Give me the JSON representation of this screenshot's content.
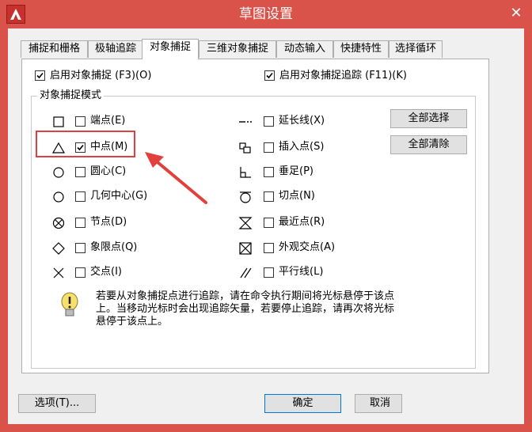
{
  "window": {
    "title": "草图设置",
    "close_glyph": "✕"
  },
  "tabs": [
    {
      "label": "捕捉和栅格"
    },
    {
      "label": "极轴追踪"
    },
    {
      "label": "对象捕捉"
    },
    {
      "label": "三维对象捕捉"
    },
    {
      "label": "动态输入"
    },
    {
      "label": "快捷特性"
    },
    {
      "label": "选择循环"
    }
  ],
  "top_options": {
    "snap_on": {
      "label": "启用对象捕捉 (F3)(O)",
      "checked": true
    },
    "tracking_on": {
      "label": "启用对象捕捉追踪 (F11)(K)",
      "checked": true
    }
  },
  "group_title": "对象捕捉模式",
  "modes_left": [
    {
      "label": "端点(E)",
      "icon": "square-icon",
      "checked": false
    },
    {
      "label": "中点(M)",
      "icon": "triangle-icon",
      "checked": true
    },
    {
      "label": "圆心(C)",
      "icon": "circle-icon",
      "checked": false
    },
    {
      "label": "几何中心(G)",
      "icon": "circle-icon",
      "checked": false
    },
    {
      "label": "节点(D)",
      "icon": "circle-x-icon",
      "checked": false
    },
    {
      "label": "象限点(Q)",
      "icon": "diamond-icon",
      "checked": false
    },
    {
      "label": "交点(I)",
      "icon": "x-icon",
      "checked": false
    }
  ],
  "modes_right": [
    {
      "label": "延长线(X)",
      "icon": "dash-dot-icon",
      "checked": false
    },
    {
      "label": "插入点(S)",
      "icon": "insert-icon",
      "checked": false
    },
    {
      "label": "垂足(P)",
      "icon": "perpendicular-icon",
      "checked": false
    },
    {
      "label": "切点(N)",
      "icon": "tangent-icon",
      "checked": false
    },
    {
      "label": "最近点(R)",
      "icon": "hourglass-icon",
      "checked": false
    },
    {
      "label": "外观交点(A)",
      "icon": "boxed-x-icon",
      "checked": false
    },
    {
      "label": "平行线(L)",
      "icon": "parallel-icon",
      "checked": false
    }
  ],
  "buttons": {
    "select_all": "全部选择",
    "clear_all": "全部清除",
    "options": "选项(T)...",
    "ok": "确定",
    "cancel": "取消"
  },
  "tip": {
    "line1": "若要从对象捕捉点进行追踪，请在命令执行期间将光标悬停于该点",
    "line2": "上。当移动光标时会出现追踪矢量，若要停止追踪，请再次将光标",
    "line3": "悬停于该点上。"
  },
  "colors": {
    "title_bar": "#d9534a",
    "annotation": "#e2403c",
    "primary_border": "#0078d7"
  }
}
